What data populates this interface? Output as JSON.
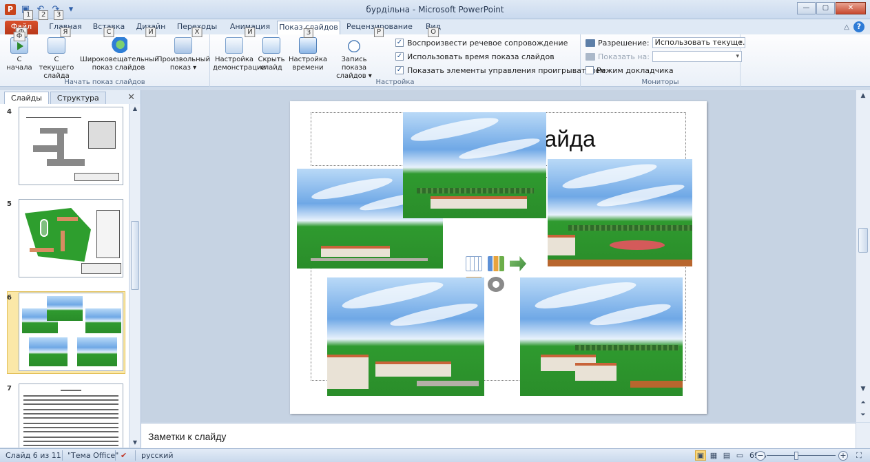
{
  "window": {
    "title": "бурдільна - Microsoft PowerPoint",
    "app_icon_letter": "P",
    "controls": {
      "minimize": "—",
      "maximize": "▢",
      "close": "✕"
    }
  },
  "quick_access": [
    {
      "icon": "save-icon",
      "glyph": "▣",
      "keytip": "1"
    },
    {
      "icon": "undo-icon",
      "glyph": "↶",
      "keytip": "2"
    },
    {
      "icon": "redo-icon",
      "glyph": "↷",
      "keytip": "3"
    },
    {
      "icon": "customize-qat-icon",
      "glyph": "▾",
      "keytip": ""
    }
  ],
  "tabs": {
    "file": {
      "label": "Файл",
      "keytip": "Ф"
    },
    "home": {
      "label": "Главная",
      "keytip": "Я"
    },
    "insert": {
      "label": "Вставка",
      "keytip": "С"
    },
    "design": {
      "label": "Дизайн",
      "keytip": "И"
    },
    "transitions": {
      "label": "Переходы",
      "keytip": "Х"
    },
    "animations": {
      "label": "Анимация",
      "keytip": "И"
    },
    "slideshow": {
      "label": "Показ слайдов",
      "keytip": "З"
    },
    "review": {
      "label": "Рецензирование",
      "keytip": "Р"
    },
    "view": {
      "label": "Вид",
      "keytip": "О"
    }
  },
  "ribbon": {
    "start_group": {
      "label": "Начать показ слайдов",
      "from_beginning": [
        "С",
        "начала"
      ],
      "from_current": [
        "С текущего",
        "слайда"
      ],
      "broadcast": [
        "Широковещательный",
        "показ слайдов"
      ],
      "custom": [
        "Произвольный",
        "показ ▾"
      ]
    },
    "setup_group": {
      "label": "Настройка",
      "setup_show": [
        "Настройка",
        "демонстрации"
      ],
      "hide_slide": [
        "Скрыть",
        "слайд"
      ],
      "rehearse": [
        "Настройка",
        "времени"
      ],
      "record": [
        "Запись показа",
        "слайдов ▾"
      ],
      "checkboxes": [
        {
          "label": "Воспроизвести речевое сопровождение",
          "checked": "✓"
        },
        {
          "label": "Использовать время показа слайдов",
          "checked": "✓"
        },
        {
          "label": "Показать элементы управления проигрывателем",
          "checked": "✓"
        }
      ]
    },
    "monitors_group": {
      "label": "Мониторы",
      "resolution_label": "Разрешение:",
      "resolution_value": "Использовать текуще...",
      "show_on_label": "Показать на:",
      "presenter_view": "Режим докладчика"
    }
  },
  "left_panel": {
    "tabs": [
      "Слайды",
      "Структура"
    ],
    "close": "✕",
    "slide_numbers": [
      "4",
      "5",
      "6",
      "7"
    ]
  },
  "slide": {
    "title_fragment": "айда"
  },
  "notes": {
    "placeholder": "Заметки к слайду"
  },
  "status": {
    "slide_info": "Слайд 6 из 11",
    "theme": "\"Тема Office\"",
    "language": "русский",
    "zoom": "69%",
    "zoom_minus": "−",
    "zoom_plus": "+"
  },
  "colors": {
    "file_tab": "#c8441b",
    "ribbon_bg": "#eaf0f8",
    "selection": "#fbe8a8",
    "grass": "#2e9e2e",
    "roof": "#c8643a"
  }
}
